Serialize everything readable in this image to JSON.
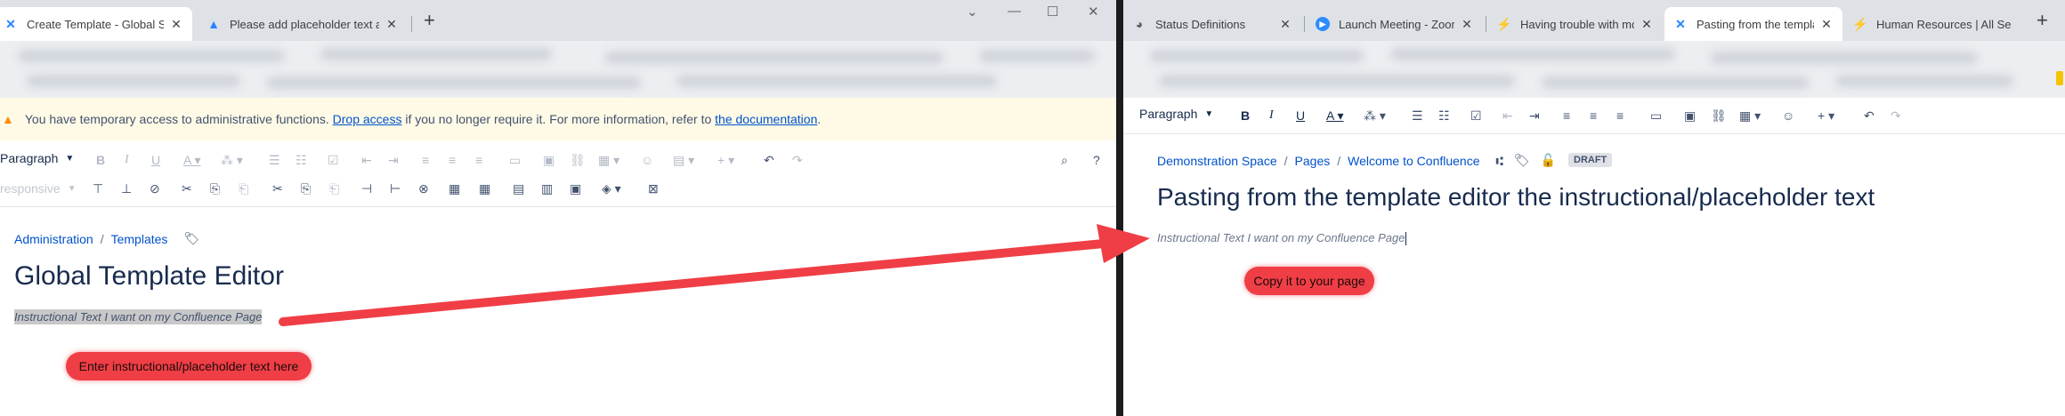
{
  "left": {
    "tabs": [
      {
        "title": "Create Template - Global Site",
        "icon": "confluence-icon",
        "active": true
      },
      {
        "title": "Please add placeholder text as a",
        "icon": "jira-icon",
        "active": false
      }
    ],
    "new_tab": "+",
    "window_controls": [
      "⌄",
      "—",
      "☐",
      "✕"
    ],
    "banner": {
      "text_before": "You have temporary access to administrative functions.",
      "link1": "Drop access",
      "text_middle": "if you no longer require it. For more information, refer to",
      "link2": "the documentation",
      "text_after": "."
    },
    "toolbar": {
      "format_select": "Paragraph",
      "second_row_select": "responsive"
    },
    "breadcrumb": [
      "Administration",
      "Templates"
    ],
    "page_title": "Global Template Editor",
    "placeholder_text": "Instructional Text I want on my Confluence Page",
    "callout": "Enter instructional/placeholder text here"
  },
  "right": {
    "tabs": [
      {
        "title": "Status Definitions",
        "icon": "status-icon",
        "active": false
      },
      {
        "title": "Launch Meeting - Zoom",
        "icon": "zoom-icon",
        "active": false
      },
      {
        "title": "Having trouble with mob",
        "icon": "jira-icon",
        "active": false
      },
      {
        "title": "Pasting from the templat",
        "icon": "confluence-icon",
        "active": true
      },
      {
        "title": "Human Resources | All Se",
        "icon": "jira-icon",
        "active": false
      }
    ],
    "new_tab": "+",
    "toolbar": {
      "format_select": "Paragraph"
    },
    "breadcrumb": [
      "Demonstration Space",
      "Pages",
      "Welcome to Confluence"
    ],
    "status_badge": "DRAFT",
    "page_title": "Pasting from the template editor the instructional/placeholder text",
    "placeholder_text": "Instructional Text I want on my Confluence Page",
    "callout": "Copy it to your page"
  },
  "colors": {
    "accent_link": "#0052cc",
    "arrow": "#f03e46",
    "banner_bg": "#fffae6",
    "tab_strip": "#dee1e6"
  }
}
